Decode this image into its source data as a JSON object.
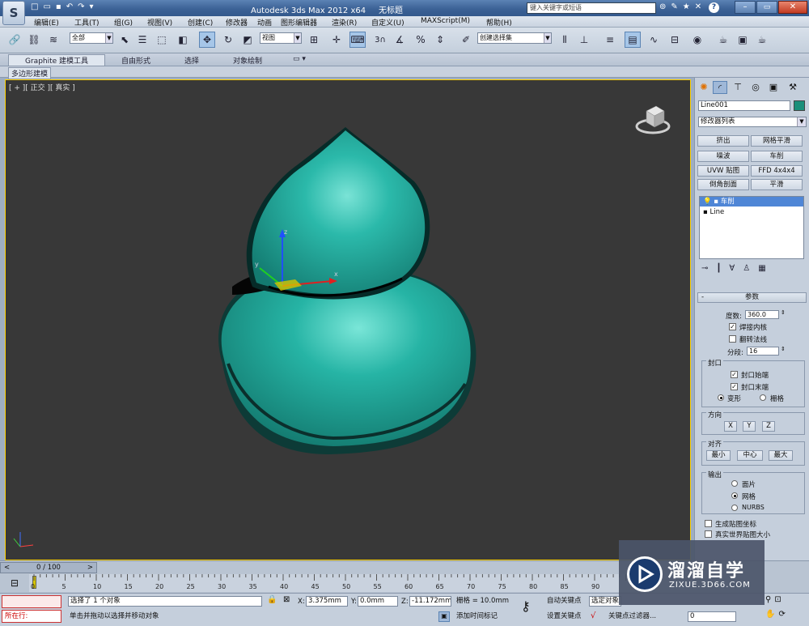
{
  "window": {
    "title": "Autodesk 3ds Max  2012 x64",
    "doc_title": "无标题",
    "search_placeholder": "键入关键字或短语"
  },
  "menu": [
    "编辑(E)",
    "工具(T)",
    "组(G)",
    "视图(V)",
    "创建(C)",
    "修改器",
    "动画",
    "图形编辑器",
    "渲染(R)",
    "自定义(U)",
    "MAXScript(M)",
    "帮助(H)"
  ],
  "toolbar": {
    "selection_filter": "全部",
    "ref_coord": "视图",
    "named_selection": "创建选择集",
    "snap_label": "3"
  },
  "ribbon": {
    "tabs": [
      "Graphite 建模工具",
      "自由形式",
      "选择",
      "对象绘制"
    ],
    "sub_label": "多边形建模"
  },
  "viewport": {
    "label": "[ + ][ 正交 ][ 真实 ]",
    "axis_x": "x",
    "axis_y": "y",
    "axis_z": "z",
    "object_color": "#1fa89a"
  },
  "command_panel": {
    "object_name": "Line001",
    "object_color": "#1b8f7a",
    "modifier_list": "修改器列表",
    "modifier_buttons": [
      "挤出",
      "网格平滑",
      "噪波",
      "车削",
      "UVW 贴图",
      "FFD 4x4x4",
      "倒角剖面",
      "平滑"
    ],
    "stack": [
      "车削",
      "Line"
    ],
    "params": {
      "title": "参数",
      "degrees_label": "度数:",
      "degrees_value": "360.0",
      "weld_core": "焊接内核",
      "flip_normals": "翻转法线",
      "segments_label": "分段:",
      "segments_value": "16",
      "capping_title": "封口",
      "cap_start": "封口始端",
      "cap_end": "封口末端",
      "morph": "变形",
      "grid": "栅格",
      "direction_title": "方向",
      "dir_x": "X",
      "dir_y": "Y",
      "dir_z": "Z",
      "align_title": "对齐",
      "align_min": "最小",
      "align_center": "中心",
      "align_max": "最大",
      "output_title": "输出",
      "out_patch": "面片",
      "out_mesh": "网格",
      "out_nurbs": "NURBS",
      "gen_map_coords": "生成贴图坐标",
      "real_world": "真实世界贴图大小"
    }
  },
  "timeline": {
    "frame": "0 / 100",
    "ticks": [
      "0",
      "5",
      "10",
      "15",
      "20",
      "25",
      "30",
      "35",
      "40",
      "45",
      "50",
      "55",
      "60",
      "65",
      "70",
      "75",
      "80",
      "85",
      "90"
    ]
  },
  "status": {
    "script_label": "所在行:",
    "selected": "选择了 1 个对象",
    "prompt": "单击并拖动以选择并移动对象",
    "x_label": "X:",
    "x_value": "3.375mm",
    "y_label": "Y:",
    "y_value": "0.0mm",
    "z_label": "Z:",
    "z_value": "-11.172mm",
    "grid": "栅格 = 10.0mm",
    "add_time_tag": "添加时间标记",
    "auto_key": "自动关键点",
    "selected_obj": "选定对象",
    "set_key": "设置关键点",
    "key_filters": "关键点过滤器...",
    "frame_value": "0"
  },
  "watermark": {
    "brand": "溜溜自学",
    "url": "ZIXUE.3D66.COM"
  }
}
